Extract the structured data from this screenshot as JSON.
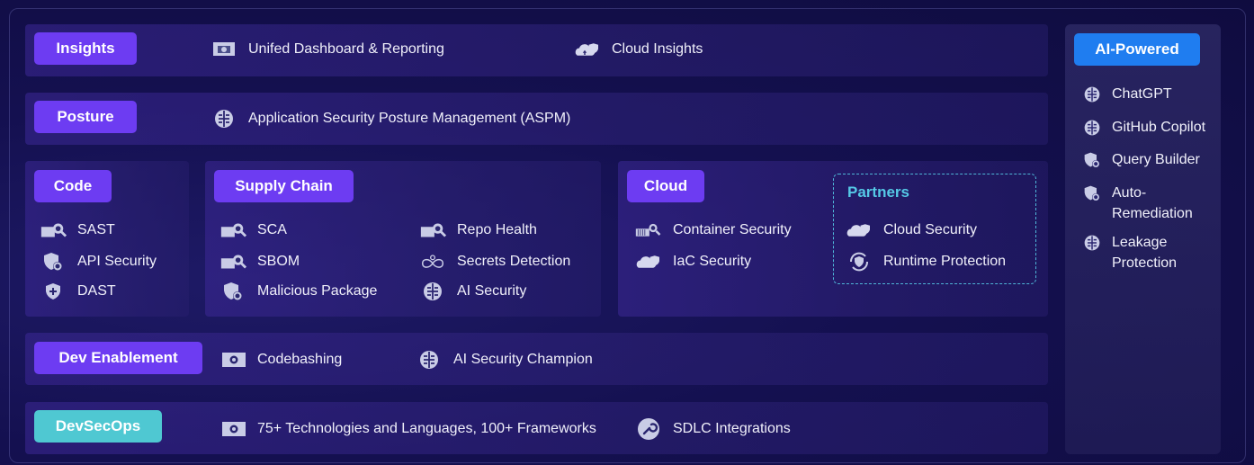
{
  "insights": {
    "tag": "Insights",
    "items": [
      "Unifed Dashboard & Reporting",
      "Cloud Insights"
    ]
  },
  "posture": {
    "tag": "Posture",
    "items": [
      "Application Security Posture Management (ASPM)"
    ]
  },
  "code": {
    "tag": "Code",
    "items": [
      "SAST",
      "API Security",
      "DAST"
    ]
  },
  "supply_chain": {
    "tag": "Supply Chain",
    "left_items": [
      "SCA",
      "SBOM",
      "Malicious Package"
    ],
    "right_items": [
      "Repo Health",
      "Secrets Detection",
      "AI Security"
    ]
  },
  "cloud": {
    "tag": "Cloud",
    "items": [
      "Container Security",
      "IaC Security"
    ]
  },
  "partners": {
    "title": "Partners",
    "items": [
      "Cloud Security",
      "Runtime Protection"
    ]
  },
  "dev_enablement": {
    "tag": "Dev Enablement",
    "items": [
      "Codebashing",
      "AI Security Champion"
    ]
  },
  "devsecops": {
    "tag": "DevSecOps",
    "items": [
      "75+ Technologies and Languages, 100+ Frameworks",
      "SDLC Integrations"
    ]
  },
  "ai_powered": {
    "tag": "AI-Powered",
    "items": [
      "ChatGPT",
      "GitHub Copilot",
      "Query Builder",
      "Auto-Remediation",
      "Leakage Protection"
    ],
    "item_lines": {
      "auto": [
        "Auto-",
        "Remediation"
      ],
      "leak": [
        "Leakage",
        "Protection"
      ]
    }
  },
  "colors": {
    "tag_purple": "#6d3cf2",
    "tag_teal": "#4fc8d2",
    "tag_blue": "#1f7df0",
    "partners_accent": "#55c9e6"
  }
}
